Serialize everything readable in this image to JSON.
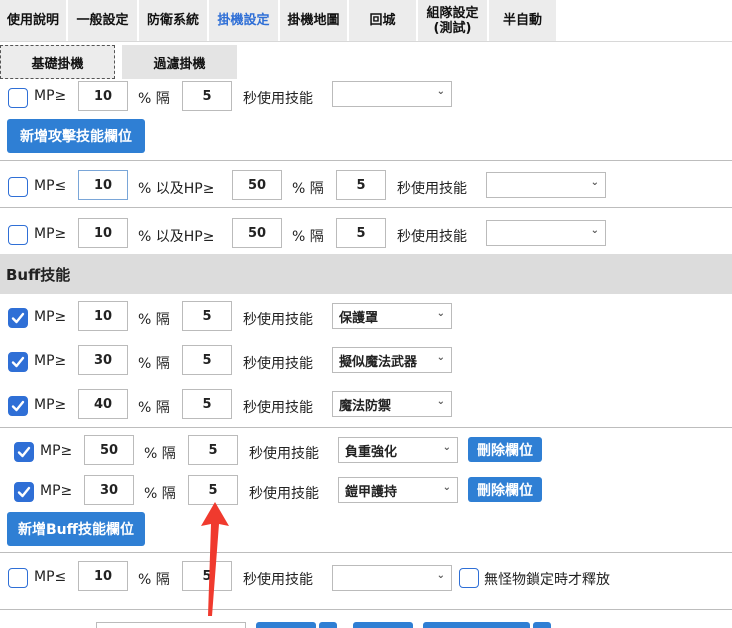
{
  "tabs": [
    {
      "label": "使用說明"
    },
    {
      "label": "一般設定"
    },
    {
      "label": "防衛系統"
    },
    {
      "label": "掛機設定",
      "active": true
    },
    {
      "label": "掛機地圖"
    },
    {
      "label": "回城"
    },
    {
      "label": "組隊設定\n(測試)"
    },
    {
      "label": "半自動"
    }
  ],
  "subtabs": [
    {
      "label": "基礎掛機",
      "active": true
    },
    {
      "label": "過濾掛機"
    }
  ],
  "texts": {
    "mp_ge": "MP≥",
    "mp_le": "MP≤",
    "pct_interval": "% 隔",
    "pct_and_hp_ge": "% 以及HP≥",
    "sec_use_skill": "秒使用技能",
    "no_monster_lock": "無怪物鎖定時才釋放"
  },
  "attack": {
    "top_row": {
      "mp": "10",
      "interval": "5",
      "skill": ""
    },
    "add_button": "新增攻擊技能欄位",
    "hp_rows": [
      {
        "op": "MP≤",
        "mp": "10",
        "hp": "50",
        "interval": "5",
        "skill": ""
      },
      {
        "op": "MP≥",
        "mp": "10",
        "hp": "50",
        "interval": "5",
        "skill": ""
      }
    ]
  },
  "buff": {
    "title": "Buff技能",
    "rows": [
      {
        "checked": true,
        "mp": "10",
        "interval": "5",
        "skill": "保護罩"
      },
      {
        "checked": true,
        "mp": "30",
        "interval": "5",
        "skill": "擬似魔法武器"
      },
      {
        "checked": true,
        "mp": "40",
        "interval": "5",
        "skill": "魔法防禦"
      }
    ],
    "custom_rows": [
      {
        "checked": true,
        "mp": "50",
        "interval": "5",
        "skill": "負重強化",
        "delete": "刪除欄位"
      },
      {
        "checked": true,
        "mp": "30",
        "interval": "5",
        "skill": "鎧甲護持",
        "delete": "刪除欄位"
      }
    ],
    "add_button": "新增Buff技能欄位"
  },
  "misc_row": {
    "mp": "10",
    "interval": "5",
    "skill": ""
  },
  "colors": {
    "accent": "#2f7fd4",
    "active_tab_text": "#2f6fd6",
    "annotation_arrow": "#f03a2e"
  }
}
